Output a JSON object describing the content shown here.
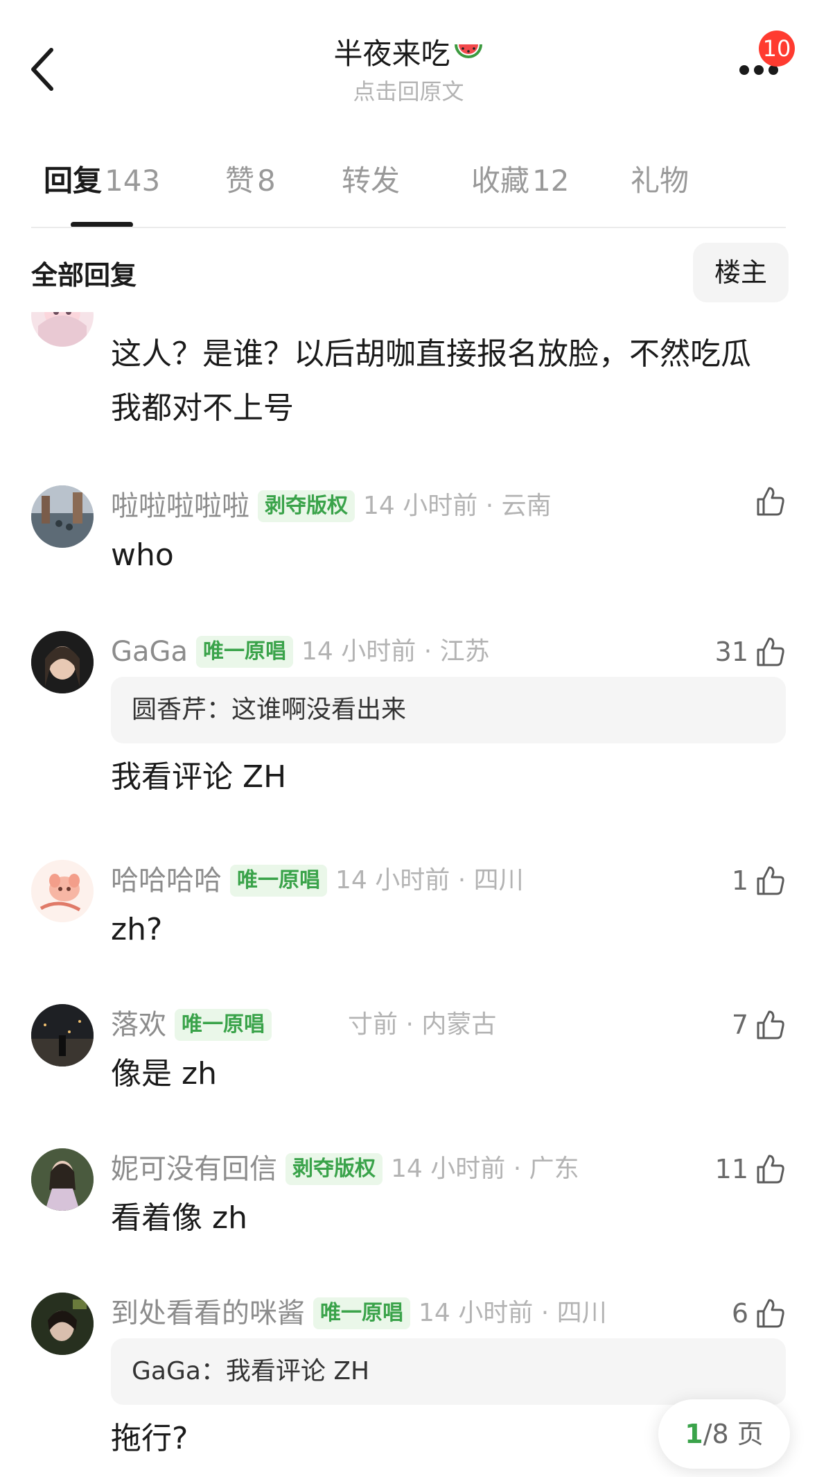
{
  "header": {
    "title": "半夜来吃",
    "subtitle": "点击回原文",
    "badge": "10",
    "title_icon": "watermelon-emoji"
  },
  "tabs": [
    {
      "label": "回复",
      "count": "143"
    },
    {
      "label": "赞",
      "count": "8"
    },
    {
      "label": "转发",
      "count": ""
    },
    {
      "label": "收藏",
      "count": "12"
    },
    {
      "label": "礼物",
      "count": ""
    }
  ],
  "filter": {
    "label": "全部回复",
    "owner_button": "楼主"
  },
  "comments": [
    {
      "user": "",
      "tag": "",
      "time": "",
      "likes": "",
      "quote": "",
      "text": "这人？是谁？以后胡咖直接报名放脸，不然吃瓜我都对不上号"
    },
    {
      "user": "啦啦啦啦啦",
      "tag": "剥夺版权",
      "time": "14 小时前 · 云南",
      "likes": "",
      "quote": "",
      "text": "who"
    },
    {
      "user": "GaGa",
      "tag": "唯一原唱",
      "time": "14 小时前 · 江苏",
      "likes": "31",
      "quote": "圆香芹：这谁啊没看出来",
      "text": "我看评论 ZH"
    },
    {
      "user": "哈哈哈哈",
      "tag": "唯一原唱",
      "time": "14 小时前 · 四川",
      "likes": "1",
      "quote": "",
      "text": "zh?"
    },
    {
      "user": "落欢",
      "tag": "唯一原唱",
      "time": "寸前 · 内蒙古",
      "likes": "7",
      "quote": "",
      "text": "像是 zh"
    },
    {
      "user": "妮可没有回信",
      "tag": "剥夺版权",
      "time": "14 小时前 · 广东",
      "likes": "11",
      "quote": "",
      "text": "看着像 zh"
    },
    {
      "user": "到处看看的咪酱",
      "tag": "唯一原唱",
      "time": "14 小时前 · 四川",
      "likes": "6",
      "quote": "GaGa：我看评论 ZH",
      "text": "拖行?"
    }
  ],
  "pager": {
    "current": "1",
    "total": "/8 页"
  },
  "colors": {
    "accent_green": "#3aa34a",
    "tag_bg": "#eaf7e9",
    "badge_red": "#ff3b30"
  }
}
